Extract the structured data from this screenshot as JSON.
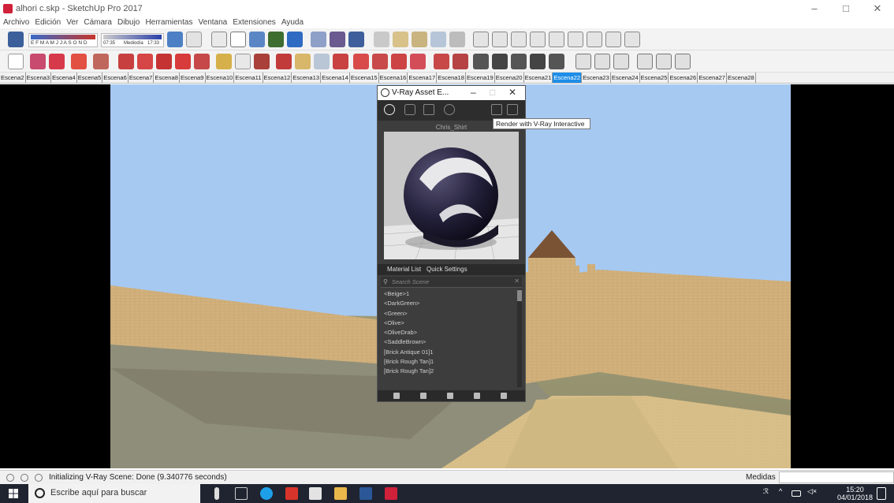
{
  "window": {
    "title": "alhori c.skp - SketchUp Pro 2017",
    "minimize": "–",
    "maximize": "□",
    "close": "✕"
  },
  "menu": [
    "Archivo",
    "Edición",
    "Ver",
    "Cámara",
    "Dibujo",
    "Herramientas",
    "Ventana",
    "Extensiones",
    "Ayuda"
  ],
  "toolbar": {
    "months": "E F M A M J J A S O N D",
    "time1": "07:35",
    "medio_dia": "Mediodía",
    "time2": "17:33"
  },
  "scenes": {
    "items": [
      "Escena2",
      "Escena3",
      "Escena4",
      "Escena5",
      "Escena6",
      "Escena7",
      "Escena8",
      "Escena9",
      "Escena10",
      "Escena11",
      "Escena12",
      "Escena13",
      "Escena14",
      "Escena15",
      "Escena16",
      "Escena17",
      "Escena18",
      "Escena19",
      "Escena20",
      "Escena21",
      "Escena22",
      "Escena23",
      "Escena24",
      "Escena25",
      "Escena26",
      "Escena27",
      "Escena28"
    ],
    "active": "Escena22"
  },
  "vray": {
    "title": "V-Ray Asset E...",
    "min": "–",
    "max": "□",
    "close": "✕",
    "material_name": "Chris_Shirt",
    "tabs": {
      "material_list": "Material List",
      "quick_settings": "Quick Settings"
    },
    "search_placeholder": "Search Scene",
    "search_clear": "✕",
    "materials": [
      "<Beige>1",
      "<DarkGreen>",
      "<Green>",
      "<Olive>",
      "<OliveDrab>",
      "<SaddleBrown>",
      "[Brick Antique 01]1",
      "[Brick Rough Tan]1",
      "[Brick Rough Tan]2"
    ]
  },
  "tooltip": "Render with V-Ray Interactive",
  "status": {
    "text": "Initializing V-Ray Scene: Done (9.340776 seconds)",
    "measure_label": "Medidas"
  },
  "taskbar": {
    "search_text": "Escribe aquí para buscar",
    "time": "15:20",
    "date": "04/01/2018"
  },
  "colors": {
    "accent": "#1e8ee8",
    "sky": "#a6c9f2",
    "ground": "#d6bd86",
    "panel": "#3d3d3d"
  }
}
